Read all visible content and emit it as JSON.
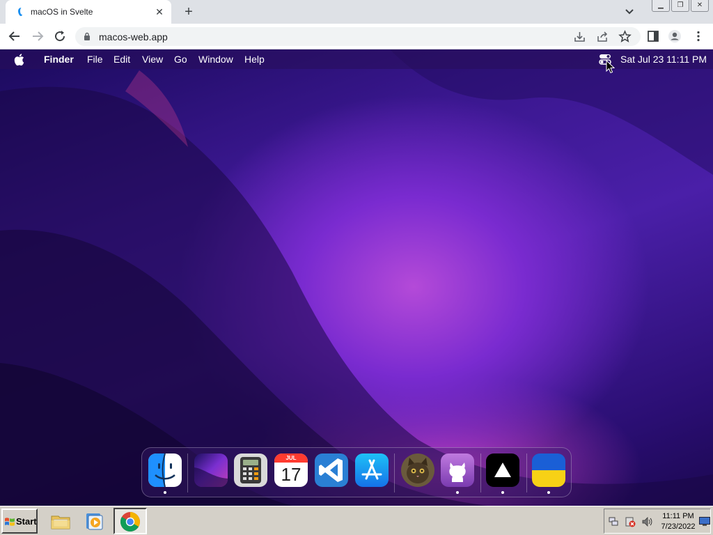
{
  "browser": {
    "tab_title": "macOS in Svelte",
    "url": "macos-web.app",
    "new_tab_symbol": "+",
    "close_symbol": "✕"
  },
  "mac": {
    "menus": [
      "Finder",
      "File",
      "Edit",
      "View",
      "Go",
      "Window",
      "Help"
    ],
    "clock": "Sat Jul 23  11:11 PM",
    "dock": [
      {
        "name": "finder",
        "running": true
      },
      {
        "name": "wallpapers",
        "running": false
      },
      {
        "name": "calculator",
        "running": false
      },
      {
        "name": "calendar",
        "running": false,
        "month": "JUL",
        "day": "17"
      },
      {
        "name": "vscode",
        "running": false
      },
      {
        "name": "app-store",
        "running": false
      },
      {
        "name": "purus-twitter",
        "running": false
      },
      {
        "name": "view-source",
        "running": true
      },
      {
        "name": "vercel",
        "running": true
      },
      {
        "name": "ukraine",
        "running": true
      }
    ]
  },
  "taskbar": {
    "start_label": "Start",
    "time": "11:11 PM",
    "date": "7/23/2022"
  },
  "colors": {
    "chrome_tabstrip": "#dee1e6",
    "omnibox": "#f1f3f4",
    "taskbar": "#d4d0c8",
    "mac_menubar": "#2a1060"
  }
}
